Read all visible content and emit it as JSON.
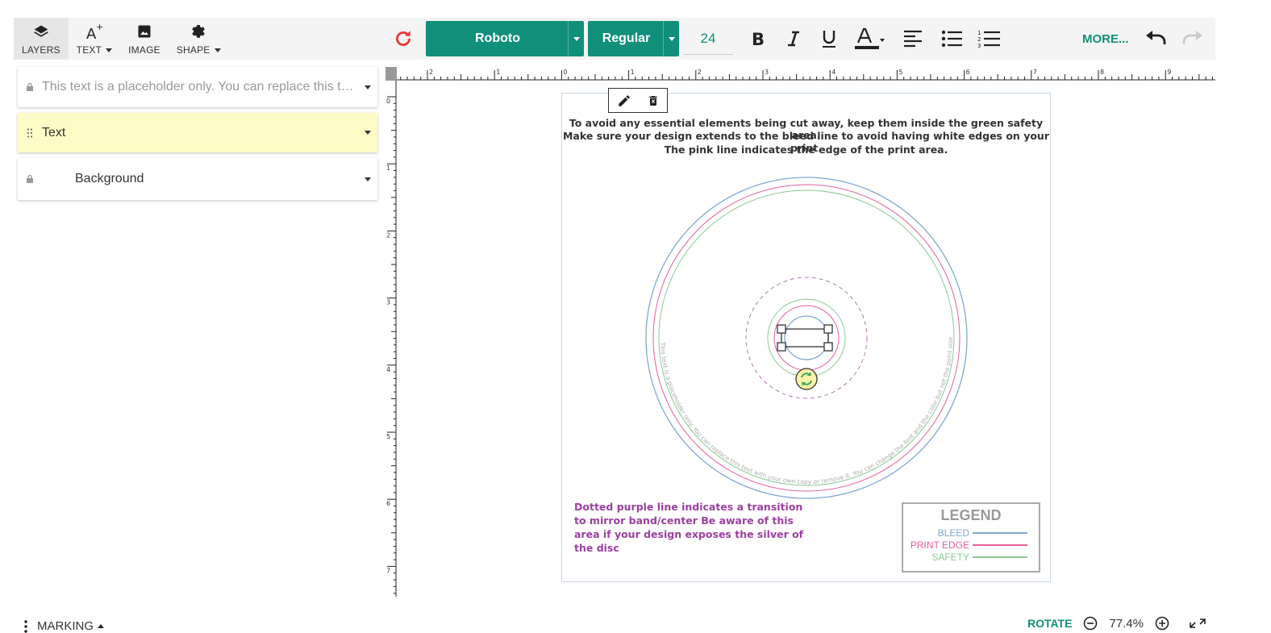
{
  "tools": [
    {
      "label": "LAYERS",
      "icon": "layers-icon",
      "caret": false,
      "active": true
    },
    {
      "label": "TEXT",
      "icon": "text-add-icon",
      "caret": true,
      "active": false
    },
    {
      "label": "IMAGE",
      "icon": "image-icon",
      "caret": false,
      "active": false
    },
    {
      "label": "SHAPE",
      "icon": "gear-icon",
      "caret": true,
      "active": false
    }
  ],
  "format_bar": {
    "font_family": "Roboto",
    "font_weight": "Regular",
    "font_size": "24",
    "more_label": "MORE...",
    "accent": "#108f7b",
    "icons": [
      "refresh-icon",
      "bold-icon",
      "italic-icon",
      "underline-icon",
      "text-color-icon",
      "align-left-icon",
      "bullet-list-icon",
      "numbered-list-icon",
      "undo-icon",
      "redo-icon"
    ]
  },
  "layers": [
    {
      "name": "This text is a placeholder only. You can replace this text with your own copy or remove it.",
      "locked": true,
      "selected": false
    },
    {
      "name": "Text",
      "locked": false,
      "selected": true
    },
    {
      "name": "Background",
      "locked": true,
      "selected": false
    }
  ],
  "ruler": {
    "h_labels": [
      "2",
      "1",
      "0",
      "1",
      "2",
      "3",
      "4",
      "5",
      "6",
      "7",
      "8",
      "9"
    ],
    "v_labels": [
      "0",
      "1",
      "2",
      "3",
      "4",
      "5",
      "6",
      "7"
    ]
  },
  "canvas": {
    "guide_lines": [
      {
        "text": "To avoid any essential elements being cut away, keep them inside the green safety area.",
        "color": "#8cc994"
      },
      {
        "text": "Make sure your design extends to the bleed line to avoid having white edges on your print.",
        "color": "#7fa8d6"
      },
      {
        "text": "The pink line indicates the edge of the print area.",
        "color": "#e85c9a"
      }
    ],
    "curved_text": "This text is a placeholder only. You can replace this text with your own copy or remove it. You can change the font and the color but not the point size.",
    "note": "Dotted purple line indicates a transition to mirror band/center Be aware of this area if your design exposes the silver of the disc",
    "legend": {
      "title": "LEGEND",
      "items": [
        {
          "label": "BLEED",
          "color": "#7fa8d6"
        },
        {
          "label": "PRINT EDGE",
          "color": "#e85c9a"
        },
        {
          "label": "SAFETY",
          "color": "#8cc994"
        }
      ]
    }
  },
  "bottom": {
    "marking_label": "MARKING",
    "rotate_label": "ROTATE",
    "zoom": "77.4%"
  }
}
